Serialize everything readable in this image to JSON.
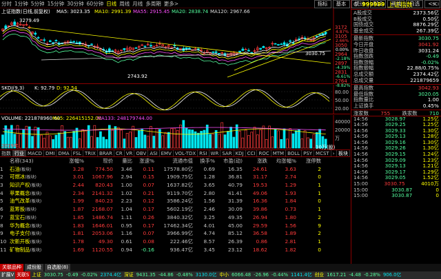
{
  "toolbar": {
    "periods": [
      "分时",
      "1分钟",
      "5分钟",
      "15分钟",
      "30分钟",
      "60分钟",
      "日线",
      "周线",
      "月线",
      "多周期",
      "更多>"
    ],
    "selected": "日线",
    "buttons": [
      "指标",
      "基本",
      "统计",
      "F10",
      "画线",
      "自选"
    ],
    "tail": "<<"
  },
  "main_chart": {
    "title": "上证指数(日线,前复权)",
    "ma5": "MA5: 3023.35",
    "ma10": "MA10: 2991.39",
    "ma55": "MA55: 2915.45",
    "ma20": "MA20: 2838.74",
    "ma120": "MA120: 2967.66",
    "high_label": "3279.49",
    "low_label": "2743.92",
    "cur_label": "3030.75",
    "axis": [
      "3172",
      "3105",
      "3050",
      "2964",
      "2897",
      "2831",
      "2764"
    ],
    "pct": [
      "4.87%",
      "2.66%",
      "0.00%",
      "-2.18%",
      "-4.39%",
      "-6.61%",
      "-8.82%"
    ],
    "rsi_axis": [
      "44.0%",
      "39.2%",
      "34.3%"
    ]
  },
  "skdj": {
    "title": "SKDJ(9,3)",
    "k": "K: 92.79",
    "d": "D: 92.54",
    "axis": [
      "80.00",
      "50.00",
      "20.00"
    ]
  },
  "volume": {
    "title": "VOLUME: 221878960.00",
    "ma5": "MA5: 226415152.00",
    "ma133": "MA133: 248179744.00",
    "axis": [
      "40000",
      "20000",
      "万"
    ],
    "year": "2019年",
    "unit_ann": "30万(股)"
  },
  "tabs": [
    "指数",
    "行业",
    "MACD",
    "DMI",
    "DMA",
    "FSL",
    "TRIX",
    "BRAR",
    "CR",
    "VR",
    "OBV",
    "ASI",
    "EMV",
    "VOL-TDX",
    "RSI",
    "WR",
    "SAR",
    "KDJ",
    "CCI",
    "ROC",
    "MTM",
    "BOLL",
    "PSY",
    "MCST",
    "›"
  ],
  "tab_right": "板块",
  "list": {
    "headers": [
      "名称(343)",
      "涨幅%",
      "现价",
      "量比",
      "涨速%",
      "流通市值",
      "换手%",
      "市盈(动)",
      "涨跌",
      "均涨幅%",
      "涨停数"
    ],
    "rows": [
      {
        "i": "1",
        "name": "石油",
        "tag": "(板块)",
        "pct": "3.28",
        "price": "774.50",
        "vr": "3.46",
        "spd": "0.11",
        "cap": "17578.80亿",
        "to": "0.69",
        "pe": "16.35",
        "chg": "24.61",
        "avg": "3.63",
        "lim": "2"
      },
      {
        "i": "2",
        "name": "可燃冰",
        "tag": "(板块)",
        "pct": "3.01",
        "price": "1067.96",
        "vr": "2.94",
        "spd": "0.15",
        "cap": "1909.75亿",
        "to": "1.28",
        "pe": "36.81",
        "chg": "31.17",
        "avg": "2.74",
        "lim": "0"
      },
      {
        "i": "3",
        "name": "知识产权",
        "tag": "(板块)",
        "pct": "2.44",
        "price": "820.43",
        "vr": "1.00",
        "spd": "0.07",
        "cap": "1637.82亿",
        "to": "3.65",
        "pe": "40.79",
        "chg": "19.53",
        "avg": "1.29",
        "lim": "1"
      },
      {
        "i": "4",
        "name": "苹果概念",
        "tag": "(板块)",
        "pct": "2.34",
        "price": "2141.32",
        "vr": "1.02",
        "spd": "0.21",
        "cap": "9119.70亿",
        "to": "2.80",
        "pe": "41.41",
        "chg": "49.06",
        "avg": "1.93",
        "lim": "1"
      },
      {
        "i": "5",
        "name": "油气改革",
        "tag": "(板块)",
        "pct": "1.99",
        "price": "840.23",
        "vr": "2.23",
        "spd": "0.12",
        "cap": "3586.24亿",
        "to": "1.56",
        "pe": "31.39",
        "chg": "16.36",
        "avg": "1.84",
        "lim": "0"
      },
      {
        "i": "6",
        "name": "蓝筹股",
        "tag": "(板块)",
        "pct": "1.87",
        "price": "2168.07",
        "vr": "1.04",
        "spd": "0.17",
        "cap": "5602.19亿",
        "to": "2.46",
        "pe": "30.09",
        "chg": "39.86",
        "avg": "0.73",
        "lim": "1"
      },
      {
        "i": "7",
        "name": "蓝宝石",
        "tag": "(板块)",
        "pct": "1.85",
        "price": "1486.74",
        "vr": "1.11",
        "spd": "0.26",
        "cap": "3840.32亿",
        "to": "3.25",
        "pe": "49.35",
        "chg": "26.94",
        "avg": "1.80",
        "lim": "2"
      },
      {
        "i": "8",
        "name": "华为概念",
        "tag": "(板块)",
        "pct": "1.83",
        "price": "1646.01",
        "vr": "0.95",
        "spd": "0.17",
        "cap": "17462.34亿",
        "to": "4.01",
        "pe": "45.00",
        "chg": "29.59",
        "avg": "1.56",
        "lim": "9"
      },
      {
        "i": "9",
        "name": "电子支付",
        "tag": "(板块)",
        "pct": "1.81",
        "price": "2053.06",
        "vr": "1.16",
        "spd": "0.07",
        "cap": "3966.99亿",
        "to": "4.74",
        "pe": "85.12",
        "chg": "36.58",
        "avg": "1.89",
        "lim": "2"
      },
      {
        "i": "10",
        "name": "次新开板",
        "tag": "(板块)",
        "pct": "1.78",
        "price": "49.30",
        "vr": "0.61",
        "spd": "0.08",
        "cap": "222.46亿",
        "to": "8.57",
        "pe": "26.39",
        "chg": "0.86",
        "avg": "2.81",
        "lim": "1"
      },
      {
        "i": "11",
        "name": "矿物制品",
        "tag": "(板块)",
        "pct": "1.69",
        "price": "1120.55",
        "vr": "0.94",
        "spd": "-0.16",
        "cap": "936.47亿",
        "to": "3.45",
        "pe": "23.12",
        "chg": "18.62",
        "avg": "1.82",
        "lim": "0"
      }
    ]
  },
  "right": {
    "code": "999999",
    "name": "上证指数",
    "letter": "G",
    "corner": "SCI",
    "block1": [
      [
        "A股成交",
        "2373.56亿"
      ],
      [
        "B股成交",
        "0.50亿"
      ],
      [
        "国债成交",
        "8876.29亿"
      ],
      [
        "基金成交",
        "267.39亿"
      ]
    ],
    "block2": [
      [
        "最新指数",
        "3030.75"
      ],
      [
        "今日开盘",
        "3041.92"
      ],
      [
        "昨日收盘",
        "3031.24"
      ],
      [
        "指数涨跌",
        "-0.49"
      ],
      [
        "指数涨幅",
        "-0.02%"
      ],
      [
        "指数振幅",
        "22.88/0.75%"
      ],
      [
        "总成交额",
        "2374.42亿"
      ],
      [
        "总成交量",
        "2218796​59"
      ]
    ],
    "block3": [
      [
        "最高指数",
        "3042.93"
      ],
      [
        "最低指数",
        "3020.05"
      ],
      [
        "指数量比",
        "1.00"
      ],
      [
        "上证换手",
        "0.45%"
      ]
    ],
    "updown": {
      "l": "涨家数",
      "lv": "755",
      "r": "跌家数",
      "rv": "710"
    },
    "ticks": [
      [
        "14:56",
        "3028.97",
        "1.25亿"
      ],
      [
        "14:56",
        "3029.25",
        "1.25亿"
      ],
      [
        "14:56",
        "3029.33",
        "1.30亿"
      ],
      [
        "14:56",
        "3029.13",
        "1.28亿"
      ],
      [
        "14:56",
        "3029.16",
        "1.30亿"
      ],
      [
        "14:56",
        "3029.26",
        "1.30亿"
      ],
      [
        "14:56",
        "3029.15",
        "1.24亿"
      ],
      [
        "14:56",
        "3029.09",
        "1.23亿"
      ],
      [
        "14:56",
        "3029.13",
        "1.21亿"
      ],
      [
        "14:56",
        "3029.17",
        "1.29亿"
      ],
      [
        "14:56",
        "3029.05",
        "1.52亿"
      ],
      [
        "15:00",
        "3030.75",
        "4010万"
      ],
      [
        "15:00",
        "3030.87",
        "0"
      ],
      [
        "15:00",
        "3030.87",
        "0"
      ]
    ]
  },
  "bottom": {
    "tabs": [
      "关联品种",
      "成份股",
      "自选股(8)"
    ],
    "status": [
      "扩展V",
      "关联S",
      "上证",
      "3030.75",
      "-0.49",
      "-0.02%",
      "2374.4亿",
      "深证",
      "9431.35",
      "-44.86",
      "-0.48%",
      "3130.0亿",
      "中小",
      "6066.48",
      "-26.96",
      "-0.44%",
      "1141.4亿",
      "创业",
      "1617.21",
      "-4.48",
      "-0.28%",
      "906.0亿"
    ]
  },
  "colors": {
    "up": "#ff3b3b",
    "down": "#54ff9f",
    "text": "#c0c0c0",
    "yellow": "#ffff00",
    "cyan": "#00e5ee"
  }
}
